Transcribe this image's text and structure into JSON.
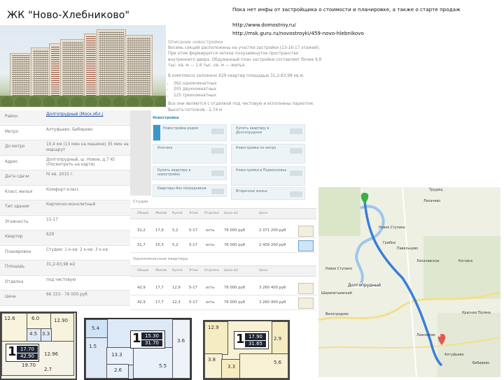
{
  "header": {
    "title": "ЖК \"Ново-Хлебниково\"",
    "note": "Пока нет инфы от застройщика о стоимости и планировке, а также о старте продаж",
    "links": [
      "http://www.domostroy.ru/",
      "http://msk.guru.ru/novostroyki/459-novo-hlebnikovo"
    ]
  },
  "description": {
    "heading": "Описание новостройки",
    "text": "Восемь секций расположены на участке застройки (13-16-17 этажей). При этом формируется четкое полузамкнутое пространство внутреннего двора. Обдуманный план застройки составляет более 9,8 тыс. кв. м — 1,6 тыс. кв. м — жилья.",
    "count_line": "В комплексе заложено 629 квартир площадью 31,2-83,98 кв.м.",
    "items": [
      "362 однокомнатных",
      "205 двухкомнатных",
      "125 трехкомнатных"
    ],
    "footer": "Все они являются с отделкой под чистовую и исполнены паркетом. Высота потолков - 2,74 м"
  },
  "info_table": [
    {
      "key": "Район",
      "value": "Долгопрудный (Моск.обл.)",
      "link": true
    },
    {
      "key": "Метро",
      "value": "Алтуфьево, Бибирево",
      "link": false
    },
    {
      "key": "До метро",
      "value": "10,4 км (13 мин на машине) 35 мин на маршрут",
      "link": false
    },
    {
      "key": "Адрес",
      "value": "Долгопрудный, ш. Новое, д.7 Ю (Посмотреть на карте)",
      "link": false
    },
    {
      "key": "Дата сдачи",
      "value": "IV кв. 2015 г.",
      "link": false
    },
    {
      "key": "Класс жилья",
      "value": "Комфорт-класс",
      "link": false
    },
    {
      "key": "Тип здания",
      "value": "Кирпично-монолитный",
      "link": false
    },
    {
      "key": "Этажность",
      "value": "15-17",
      "link": false
    },
    {
      "key": "Квартир",
      "value": "629",
      "link": false
    },
    {
      "key": "Планировки",
      "value": "Студии: 1 к-кв: 2 к-кв: 3 к-кв",
      "link": false
    },
    {
      "key": "Площадь",
      "value": "31,2-83,98 м2",
      "link": false
    },
    {
      "key": "Отделка",
      "value": "под чистовую",
      "link": false
    },
    {
      "key": "Цена",
      "value": "66 333 - 76 000 руб",
      "link": false
    }
  ],
  "panels": {
    "heading": "Новостройки",
    "items": [
      "Новостройка рядом",
      "Купить квартиру в Долгопрудном",
      "Ипотека",
      "Новостройки по метро",
      "Купить квартиру в новостройке",
      "Новостройки в Подмосковье",
      "Квартиры без посредников",
      "Вторичное жилье"
    ]
  },
  "flats": {
    "section1": "Студии",
    "section2": "Однокомнатные квартиры",
    "columns": [
      "Общая",
      "Жилая",
      "Кухня",
      "Этаж",
      "Отделка",
      "Цена м2",
      "Цена"
    ],
    "rows1": [
      [
        "31,2",
        "17,9",
        "5,2",
        "5-17",
        "есть",
        "76 000 руб",
        "2 371 200 руб"
      ],
      [
        "31,7",
        "15,3",
        "5,2",
        "5-17",
        "есть",
        "76 000 руб",
        "2 409 200 руб"
      ]
    ],
    "rows2": [
      [
        "42,9",
        "17,7",
        "12,9",
        "5-17",
        "есть",
        "76 000 руб",
        "3 260 400 руб"
      ],
      [
        "42,9",
        "17,7",
        "12,3",
        "5-17",
        "есть",
        "76 000 руб",
        "3 260 400 руб"
      ]
    ]
  },
  "map": {
    "labels": [
      "Новое Ступино",
      "Лихачево",
      "Грибки",
      "Павельцево",
      "Долгопрудный",
      "Шереметьевский",
      "Котовск",
      "Красная Поляна",
      "Алтуфьево",
      "Бибирево",
      "Лианозово",
      "Виноградово",
      "Новое Ступино",
      "Трудящ",
      "Лихачевское"
    ],
    "marker_a": "A",
    "marker_b": "B",
    "route_color": "#3a7fd8"
  },
  "plans": {
    "plan1": {
      "rooms": [
        "12.6",
        "12.90",
        "6.0",
        "4.5",
        "3.3",
        "12.96",
        "19.70",
        "2.7"
      ],
      "number": "1",
      "area_total": "17.70",
      "area_living": "42.90"
    },
    "plan2": {
      "rooms": [
        "5.4",
        "1.5",
        "13.3",
        "2.6",
        "5.5",
        "3.6"
      ],
      "number": "1",
      "area_total": "15.30",
      "area_living": "31.70"
    },
    "plan3": {
      "rooms": [
        "12.9",
        "2.9",
        "3.8",
        "3.3",
        "5.6"
      ],
      "number": "1",
      "area_total": "17.90",
      "area_living": "31.65"
    }
  }
}
